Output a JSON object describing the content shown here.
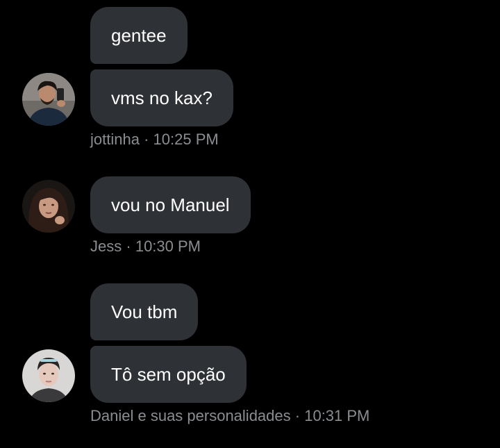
{
  "groups": [
    {
      "sender": "jottinha",
      "time": "10:25 PM",
      "separator": "·",
      "messages": [
        "gentee",
        "vms no kax?"
      ],
      "avatar_icon": "man-with-phone-selfie-avatar-icon"
    },
    {
      "sender": "Jess",
      "time": "10:30 PM",
      "separator": "·",
      "messages": [
        "vou no Manuel"
      ],
      "avatar_icon": "woman-dark-hair-avatar-icon"
    },
    {
      "sender": "Daniel e suas personalidades",
      "time": "10:31 PM",
      "separator": "·",
      "messages": [
        "Vou tbm",
        "Tô sem opção"
      ],
      "avatar_icon": "young-man-portrait-avatar-icon"
    }
  ],
  "colors": {
    "background": "#000000",
    "bubble": "#2e3135",
    "message_text": "#ffffff",
    "meta_text": "#8a8d91"
  }
}
